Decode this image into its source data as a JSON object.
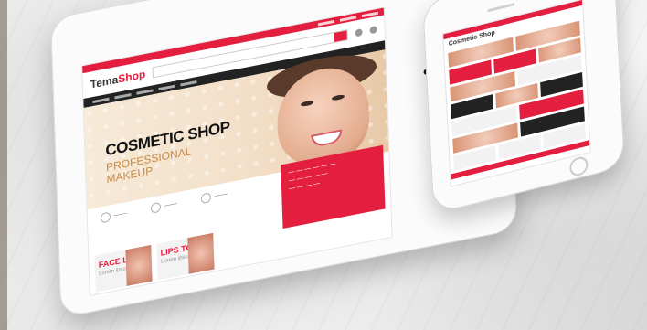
{
  "scene": "tablet-and-phone-mockup",
  "colors": {
    "accent": "#e41e3f",
    "dark": "#222222",
    "tab_accent": "#2aa4d9"
  },
  "tablet": {
    "logo_prefix": "Tema",
    "logo_suffix": "Shop",
    "hero_title": "COSMETIC SHOP",
    "hero_sub_1": "PROFESSIONAL",
    "hero_sub_2": "MAKEUP",
    "tiles": [
      {
        "title": "FACE LIFT",
        "sub": "Lorem ipsum"
      },
      {
        "title": "LIPS TO",
        "sub": "Lorem ipsum"
      }
    ]
  },
  "phone": {
    "logo": "Cosmetic Shop"
  }
}
